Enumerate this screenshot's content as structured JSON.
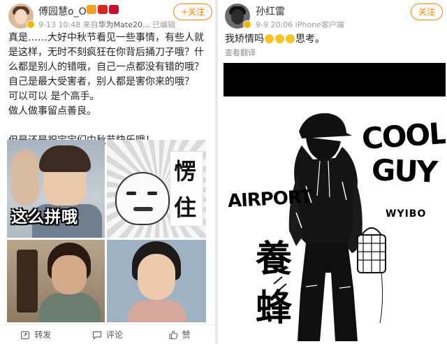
{
  "left_post": {
    "username": "傅园慧o_O",
    "meta": {
      "date": "9-13 10:48",
      "source_prefix": "来自",
      "source_device": "华为Mate20...",
      "status": "已编辑"
    },
    "follow_label": "+关注",
    "text_lines": [
      "真是……大好中秋节看见一些事情，有些人就",
      "是这样，无时不刻疯狂在你背后捅刀子哦？什",
      "么都是别人的错哦，自己一点都没有错的哦？",
      "自己是最大受害者，别人都是害你来的哦？",
      "可以可以 是个高手。",
      "做人做事留点善良。"
    ],
    "closing_line": "但是还是祝宝宝们中秋节快乐哦！",
    "images": {
      "meme1_caption": "这么拼哦",
      "meme2_char1": "愣",
      "meme2_char2": "住"
    },
    "actions": {
      "repost": "转发",
      "comment": "评论",
      "like": "赞"
    }
  },
  "right_post": {
    "username": "孙红雷",
    "meta": {
      "date": "9-9 20:06",
      "source": "iPhone客户端"
    },
    "follow_label": "关注",
    "text_before": "我矫情吗",
    "text_after": "思考。",
    "emoji_count": 3,
    "translate_label": "查看翻译",
    "artwork": {
      "cool": "COOL",
      "guy": "GUY",
      "airport": "AIRPORT",
      "wyibo": "WYIBO",
      "char1": "養",
      "char2": "蜂"
    }
  },
  "colors": {
    "accent": "#ff8200",
    "meta_gray": "#999999",
    "verified": "#f5b400"
  }
}
